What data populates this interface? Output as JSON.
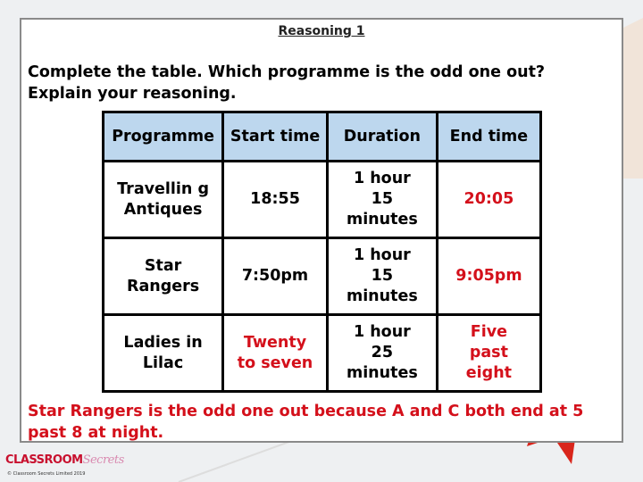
{
  "title": "Reasoning 1",
  "question": "Complete the table. Which programme is the odd one out? Explain your reasoning.",
  "table": {
    "headers": [
      "Programme",
      "Start time",
      "Duration",
      "End time"
    ],
    "rows": [
      [
        "Travellin g Antiques",
        "18:55",
        "1 hour 15 minutes",
        "20:05"
      ],
      [
        "Star Rangers",
        "7:50pm",
        "1 hour 15 minutes",
        "9:05pm"
      ],
      [
        "Ladies in Lilac",
        "Twenty to seven",
        "1 hour 25 minutes",
        "Five past eight"
      ]
    ]
  },
  "answer": "Star Rangers is the odd one out because A and C both end at 5 past 8 at night.",
  "logo": {
    "word1": "CLASSROOM",
    "word2": "Secrets"
  },
  "copyright": "© Classroom Secrets Limited 2019",
  "colors": {
    "header": "#bdd7ee",
    "answer": "#d4101b"
  }
}
